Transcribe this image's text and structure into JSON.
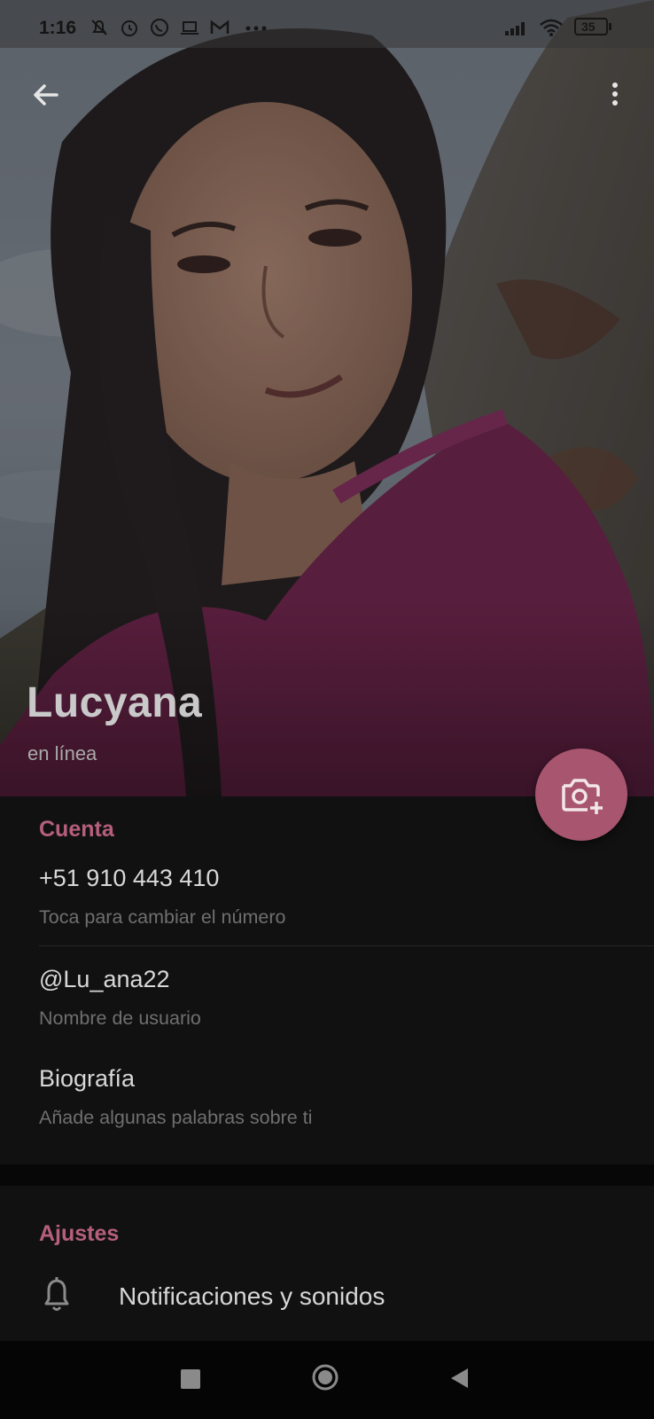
{
  "status_bar": {
    "time": "1:16",
    "left_icons": [
      "muted-bell-icon",
      "alarm-icon",
      "whatsapp-icon",
      "laptop-icon",
      "gmail-icon",
      "more-dots-icon"
    ],
    "right_icons": [
      "signal-icon",
      "wifi-icon",
      "battery-icon"
    ],
    "battery": "35"
  },
  "app_bar": {
    "back_icon": "arrow-back-icon",
    "menu_icon": "more-vertical-icon"
  },
  "profile": {
    "name": "Lucyana",
    "status": "en línea",
    "camera_icon": "add-photo-camera-icon"
  },
  "account": {
    "title": "Cuenta",
    "phone": "+51 910 443 410",
    "phone_hint": "Toca para cambiar el número",
    "username": "@Lu_ana22",
    "username_hint": "Nombre de usuario",
    "bio": "Biografía",
    "bio_hint": "Añade algunas palabras sobre ti"
  },
  "settings": {
    "title": "Ajustes",
    "items": [
      {
        "icon": "bell-icon",
        "label": "Notificaciones y sonidos"
      }
    ]
  },
  "nav": {
    "recents_icon": "square-icon",
    "home_icon": "circle-icon",
    "back_icon": "triangle-back-icon"
  },
  "colors": {
    "accent": "#b55f7c",
    "fab": "#a8556f",
    "background": "#111111"
  }
}
